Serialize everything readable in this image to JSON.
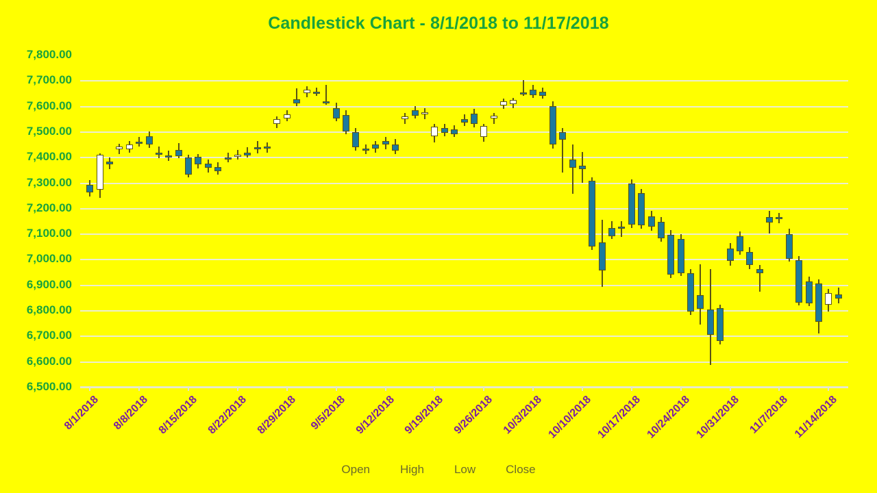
{
  "title": "Candlestick Chart - 8/1/2018 to 11/17/2018",
  "colors": {
    "background": "#ffff00",
    "title": "#19a23c",
    "y_axis_label": "#19a23c",
    "x_axis_label": "#7a1fa0",
    "gridline": "#eceed0",
    "up_candle_fill": "#ffffff",
    "down_candle_fill": "#1b7a9e",
    "candle_border": "#5a5414",
    "legend_text": "#6b6b2a"
  },
  "legend": {
    "position": "bottom",
    "items": [
      "Open",
      "High",
      "Low",
      "Close"
    ]
  },
  "chart_data": {
    "type": "candlestick",
    "title": "Candlestick Chart - 8/1/2018 to 11/17/2018",
    "xlabel": "",
    "ylabel": "",
    "ylim": [
      6500,
      7800
    ],
    "y_tick_step": 100,
    "grid": true,
    "y_ticks": [
      "7,800.00",
      "7,700.00",
      "7,600.00",
      "7,500.00",
      "7,400.00",
      "7,300.00",
      "7,200.00",
      "7,100.00",
      "7,000.00",
      "6,900.00",
      "6,800.00",
      "6,700.00",
      "6,600.00",
      "6,500.00"
    ],
    "x_ticks": [
      "8/1/2018",
      "8/8/2018",
      "8/15/2018",
      "8/22/2018",
      "8/29/2018",
      "9/5/2018",
      "9/12/2018",
      "9/19/2018",
      "9/26/2018",
      "10/3/2018",
      "10/10/2018",
      "10/17/2018",
      "10/24/2018",
      "10/31/2018",
      "11/7/2018",
      "11/14/2018"
    ],
    "x_tick_indices": [
      0,
      5,
      10,
      15,
      20,
      25,
      30,
      35,
      40,
      45,
      50,
      55,
      60,
      65,
      70,
      75
    ],
    "series_fields": [
      "Open",
      "High",
      "Low",
      "Close"
    ],
    "ohlc": [
      {
        "date": "8/1/2018",
        "open": 7290,
        "high": 7310,
        "low": 7245,
        "close": 7262
      },
      {
        "date": "8/2/2018",
        "open": 7272,
        "high": 7415,
        "low": 7240,
        "close": 7408
      },
      {
        "date": "8/3/2018",
        "open": 7382,
        "high": 7398,
        "low": 7352,
        "close": 7370
      },
      {
        "date": "8/6/2018",
        "open": 7430,
        "high": 7452,
        "low": 7410,
        "close": 7440
      },
      {
        "date": "8/7/2018",
        "open": 7430,
        "high": 7462,
        "low": 7418,
        "close": 7448
      },
      {
        "date": "8/8/2018",
        "open": 7460,
        "high": 7478,
        "low": 7440,
        "close": 7452
      },
      {
        "date": "8/9/2018",
        "open": 7482,
        "high": 7500,
        "low": 7435,
        "close": 7448
      },
      {
        "date": "8/10/2018",
        "open": 7418,
        "high": 7440,
        "low": 7395,
        "close": 7412
      },
      {
        "date": "8/13/2018",
        "open": 7405,
        "high": 7425,
        "low": 7385,
        "close": 7400
      },
      {
        "date": "8/14/2018",
        "open": 7428,
        "high": 7455,
        "low": 7396,
        "close": 7402
      },
      {
        "date": "8/15/2018",
        "open": 7398,
        "high": 7410,
        "low": 7320,
        "close": 7332
      },
      {
        "date": "8/16/2018",
        "open": 7400,
        "high": 7412,
        "low": 7355,
        "close": 7372
      },
      {
        "date": "8/17/2018",
        "open": 7375,
        "high": 7390,
        "low": 7340,
        "close": 7358
      },
      {
        "date": "8/20/2018",
        "open": 7360,
        "high": 7378,
        "low": 7330,
        "close": 7345
      },
      {
        "date": "8/21/2018",
        "open": 7398,
        "high": 7418,
        "low": 7378,
        "close": 7392
      },
      {
        "date": "8/22/2018",
        "open": 7400,
        "high": 7428,
        "low": 7390,
        "close": 7408
      },
      {
        "date": "8/23/2018",
        "open": 7418,
        "high": 7438,
        "low": 7398,
        "close": 7405
      },
      {
        "date": "8/24/2018",
        "open": 7438,
        "high": 7462,
        "low": 7415,
        "close": 7430
      },
      {
        "date": "8/27/2018",
        "open": 7440,
        "high": 7458,
        "low": 7418,
        "close": 7432
      },
      {
        "date": "8/28/2018",
        "open": 7528,
        "high": 7560,
        "low": 7512,
        "close": 7548
      },
      {
        "date": "8/29/2018",
        "open": 7552,
        "high": 7582,
        "low": 7540,
        "close": 7566
      },
      {
        "date": "8/30/2018",
        "open": 7625,
        "high": 7668,
        "low": 7600,
        "close": 7610
      },
      {
        "date": "8/31/2018",
        "open": 7650,
        "high": 7678,
        "low": 7635,
        "close": 7662
      },
      {
        "date": "9/4/2018",
        "open": 7655,
        "high": 7672,
        "low": 7640,
        "close": 7648
      },
      {
        "date": "9/5/2018",
        "open": 7618,
        "high": 7682,
        "low": 7605,
        "close": 7612
      },
      {
        "date": "9/6/2018",
        "open": 7592,
        "high": 7612,
        "low": 7540,
        "close": 7552
      },
      {
        "date": "9/7/2018",
        "open": 7565,
        "high": 7582,
        "low": 7490,
        "close": 7500
      },
      {
        "date": "9/10/2018",
        "open": 7498,
        "high": 7512,
        "low": 7425,
        "close": 7438
      },
      {
        "date": "9/11/2018",
        "open": 7432,
        "high": 7448,
        "low": 7410,
        "close": 7428
      },
      {
        "date": "9/12/2018",
        "open": 7448,
        "high": 7462,
        "low": 7418,
        "close": 7432
      },
      {
        "date": "9/13/2018",
        "open": 7462,
        "high": 7478,
        "low": 7430,
        "close": 7448
      },
      {
        "date": "9/14/2018",
        "open": 7450,
        "high": 7470,
        "low": 7410,
        "close": 7425
      },
      {
        "date": "9/17/2018",
        "open": 7548,
        "high": 7572,
        "low": 7528,
        "close": 7560
      },
      {
        "date": "9/18/2018",
        "open": 7582,
        "high": 7598,
        "low": 7552,
        "close": 7562
      },
      {
        "date": "9/19/2018",
        "open": 7570,
        "high": 7590,
        "low": 7548,
        "close": 7576
      },
      {
        "date": "9/20/2018",
        "open": 7482,
        "high": 7530,
        "low": 7458,
        "close": 7518
      },
      {
        "date": "9/21/2018",
        "open": 7512,
        "high": 7530,
        "low": 7482,
        "close": 7495
      },
      {
        "date": "9/24/2018",
        "open": 7508,
        "high": 7524,
        "low": 7478,
        "close": 7490
      },
      {
        "date": "9/25/2018",
        "open": 7548,
        "high": 7568,
        "low": 7520,
        "close": 7535
      },
      {
        "date": "9/26/2018",
        "open": 7570,
        "high": 7588,
        "low": 7515,
        "close": 7528
      },
      {
        "date": "9/27/2018",
        "open": 7478,
        "high": 7530,
        "low": 7460,
        "close": 7522
      },
      {
        "date": "9/28/2018",
        "open": 7552,
        "high": 7572,
        "low": 7528,
        "close": 7562
      },
      {
        "date": "10/1/2018",
        "open": 7602,
        "high": 7628,
        "low": 7588,
        "close": 7618
      },
      {
        "date": "10/2/2018",
        "open": 7608,
        "high": 7632,
        "low": 7592,
        "close": 7622
      },
      {
        "date": "10/3/2018",
        "open": 7652,
        "high": 7700,
        "low": 7638,
        "close": 7648
      },
      {
        "date": "10/4/2018",
        "open": 7662,
        "high": 7682,
        "low": 7632,
        "close": 7642
      },
      {
        "date": "10/5/2018",
        "open": 7655,
        "high": 7672,
        "low": 7628,
        "close": 7638
      },
      {
        "date": "10/8/2018",
        "open": 7600,
        "high": 7618,
        "low": 7432,
        "close": 7448
      },
      {
        "date": "10/9/2018",
        "open": 7498,
        "high": 7512,
        "low": 7340,
        "close": 7468
      },
      {
        "date": "10/10/2018",
        "open": 7390,
        "high": 7448,
        "low": 7255,
        "close": 7358
      },
      {
        "date": "10/11/2018",
        "open": 7365,
        "high": 7420,
        "low": 7300,
        "close": 7352
      },
      {
        "date": "10/12/2018",
        "open": 7308,
        "high": 7320,
        "low": 7035,
        "close": 7050
      },
      {
        "date": "10/15/2018",
        "open": 7065,
        "high": 7155,
        "low": 6890,
        "close": 6955
      },
      {
        "date": "10/16/2018",
        "open": 7122,
        "high": 7148,
        "low": 7078,
        "close": 7090
      },
      {
        "date": "10/17/2018",
        "open": 7128,
        "high": 7148,
        "low": 7088,
        "close": 7118
      },
      {
        "date": "10/18/2018",
        "open": 7295,
        "high": 7312,
        "low": 7122,
        "close": 7135
      },
      {
        "date": "10/19/2018",
        "open": 7258,
        "high": 7275,
        "low": 7118,
        "close": 7132
      },
      {
        "date": "10/22/2018",
        "open": 7168,
        "high": 7190,
        "low": 7112,
        "close": 7128
      },
      {
        "date": "10/23/2018",
        "open": 7145,
        "high": 7165,
        "low": 7068,
        "close": 7082
      },
      {
        "date": "10/24/2018",
        "open": 7095,
        "high": 7115,
        "low": 6925,
        "close": 6940
      },
      {
        "date": "10/25/2018",
        "open": 7078,
        "high": 7098,
        "low": 6935,
        "close": 6945
      },
      {
        "date": "10/26/2018",
        "open": 6945,
        "high": 6962,
        "low": 6782,
        "close": 6795
      },
      {
        "date": "10/29/2018",
        "open": 6858,
        "high": 6980,
        "low": 6745,
        "close": 6805
      },
      {
        "date": "10/30/2018",
        "open": 6802,
        "high": 6962,
        "low": 6585,
        "close": 6705
      },
      {
        "date": "10/31/2018",
        "open": 6808,
        "high": 6822,
        "low": 6665,
        "close": 6680
      },
      {
        "date": "11/1/2018",
        "open": 7042,
        "high": 7062,
        "low": 6975,
        "close": 6992
      },
      {
        "date": "11/2/2018",
        "open": 7090,
        "high": 7108,
        "low": 7018,
        "close": 7032
      },
      {
        "date": "11/5/2018",
        "open": 7028,
        "high": 7048,
        "low": 6962,
        "close": 6978
      },
      {
        "date": "11/6/2018",
        "open": 6962,
        "high": 6978,
        "low": 6872,
        "close": 6945
      },
      {
        "date": "11/7/2018",
        "open": 7165,
        "high": 7188,
        "low": 7100,
        "close": 7142
      },
      {
        "date": "11/8/2018",
        "open": 7165,
        "high": 7182,
        "low": 7140,
        "close": 7158
      },
      {
        "date": "11/9/2018",
        "open": 7098,
        "high": 7118,
        "low": 6990,
        "close": 7002
      },
      {
        "date": "11/12/2018",
        "open": 6995,
        "high": 7012,
        "low": 6818,
        "close": 6830
      },
      {
        "date": "11/13/2018",
        "open": 6912,
        "high": 6932,
        "low": 6815,
        "close": 6828
      },
      {
        "date": "11/14/2018",
        "open": 6905,
        "high": 6922,
        "low": 6710,
        "close": 6755
      },
      {
        "date": "11/15/2018",
        "open": 6822,
        "high": 6882,
        "low": 6795,
        "close": 6868
      },
      {
        "date": "11/16/2018",
        "open": 6862,
        "high": 6888,
        "low": 6828,
        "close": 6845
      }
    ]
  }
}
